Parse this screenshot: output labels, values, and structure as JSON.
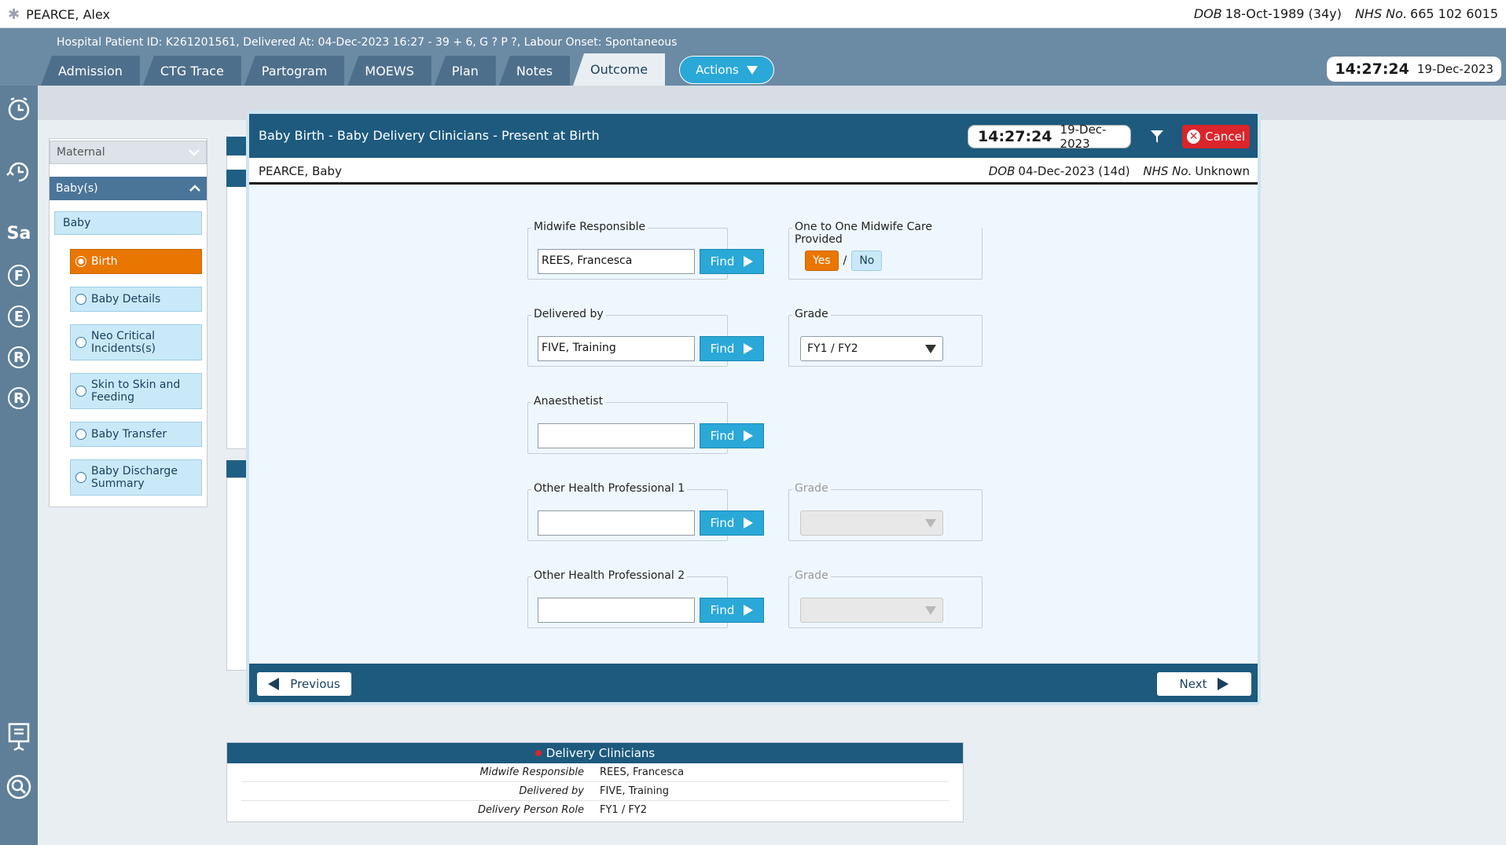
{
  "patient": {
    "name": "PEARCE, Alex",
    "dob_label": "DOB",
    "dob": "18-Oct-1989 (34y)",
    "nhs_label": "NHS No.",
    "nhs": "665 102 6015",
    "info_line": "Hospital Patient ID: K261201561, Delivered At: 04-Dec-2023 16:27 - 39 + 6, G ? P ?,   Labour Onset: Spontaneous"
  },
  "tabs": [
    {
      "label": "Admission"
    },
    {
      "label": "CTG Trace"
    },
    {
      "label": "Partogram"
    },
    {
      "label": "MOEWS"
    },
    {
      "label": "Plan"
    },
    {
      "label": "Notes"
    },
    {
      "label": "Outcome"
    }
  ],
  "actions_label": "Actions",
  "header_clock": {
    "time": "14:27:24",
    "date": "19-Dec-2023"
  },
  "rail": {
    "sa": "Sa",
    "f": "F",
    "e": "E",
    "r1": "R",
    "r2": "R"
  },
  "nav": {
    "maternal": "Maternal",
    "babies": "Baby(s)",
    "baby": "Baby",
    "items": [
      {
        "label": "Birth"
      },
      {
        "label": "Baby Details"
      },
      {
        "label": "Neo Critical Incidents(s)"
      },
      {
        "label": "Skin to Skin and Feeding"
      },
      {
        "label": "Baby Transfer"
      },
      {
        "label": "Baby Discharge Summary"
      }
    ]
  },
  "modal": {
    "title": "Baby Birth - Baby Delivery Clinicians - Present at Birth",
    "clock": {
      "time": "14:27:24",
      "date": "19-Dec-2023"
    },
    "cancel_label": "Cancel",
    "baby_name": "PEARCE, Baby",
    "baby_dob_label": "DOB",
    "baby_dob": "04-Dec-2023 (14d)",
    "baby_nhs_label": "NHS No.",
    "baby_nhs": "Unknown",
    "find_label": "Find",
    "midwife": {
      "legend": "Midwife Responsible",
      "value": "REES, Francesca"
    },
    "one_to_one": {
      "legend": "One to One Midwife Care Provided",
      "yes": "Yes",
      "sep": "/",
      "no": "No"
    },
    "delivered_by": {
      "legend": "Delivered by",
      "value": "FIVE, Training"
    },
    "grade": {
      "legend": "Grade",
      "value": "FY1 / FY2"
    },
    "anaesthetist": {
      "legend": "Anaesthetist",
      "value": ""
    },
    "other1": {
      "legend": "Other Health Professional 1",
      "value": ""
    },
    "grade2": {
      "legend": "Grade",
      "value": ""
    },
    "other2": {
      "legend": "Other Health Professional 2",
      "value": ""
    },
    "grade3": {
      "legend": "Grade",
      "value": ""
    },
    "previous_label": "Previous",
    "next_label": "Next"
  },
  "summary": {
    "title": "Delivery Clinicians",
    "rows": [
      {
        "label": "Midwife Responsible",
        "value": "REES, Francesca"
      },
      {
        "label": "Delivered by",
        "value": "FIVE, Training"
      },
      {
        "label": "Delivery Person Role",
        "value": "FY1 / FY2"
      }
    ]
  },
  "colors": {
    "header_blue": "#1d5a7e",
    "accent_cyan": "#2aa8d8",
    "active_orange": "#e97600",
    "cancel_red": "#d9252b"
  }
}
